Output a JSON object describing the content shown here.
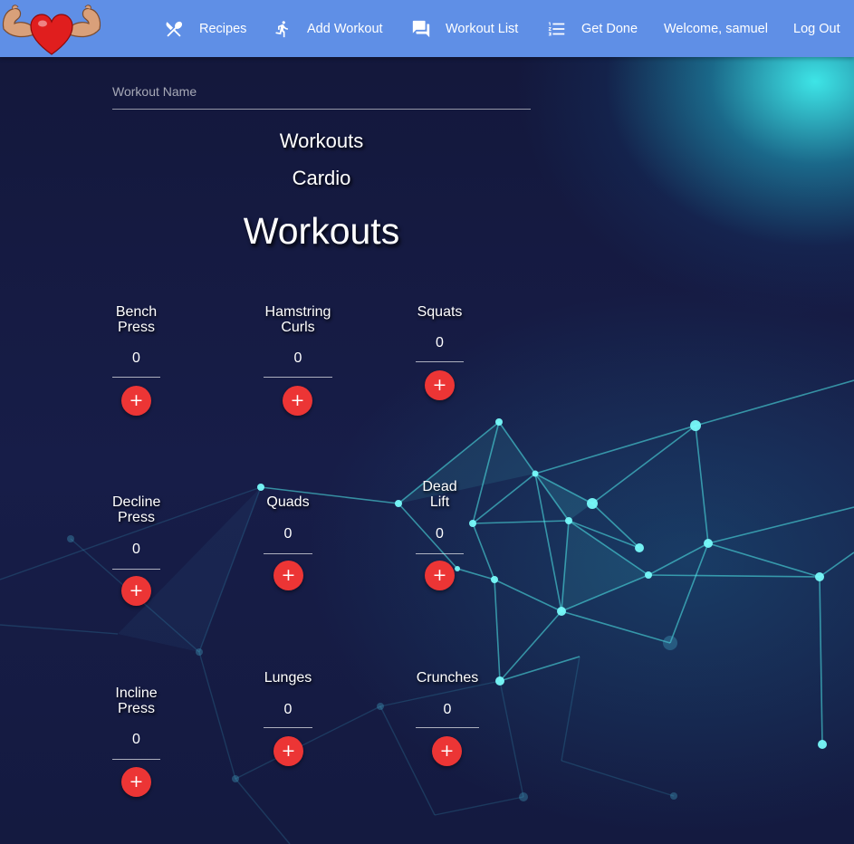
{
  "nav": {
    "items": [
      {
        "label": "Recipes",
        "icon": "fork-knife-icon"
      },
      {
        "label": "Add Workout",
        "icon": "running-person-icon"
      },
      {
        "label": "Workout List",
        "icon": "chat-bubbles-icon"
      },
      {
        "label": "Get Done",
        "icon": "numbered-list-icon"
      }
    ],
    "welcome": "Welcome, samuel",
    "logout": "Log Out"
  },
  "form": {
    "name_placeholder": "Workout Name",
    "name_value": ""
  },
  "categories": [
    "Workouts",
    "Cardio"
  ],
  "section_title": "Workouts",
  "workouts": [
    {
      "name": "Bench\nPress",
      "count": "0",
      "add": "+"
    },
    {
      "name": "Hamstring\nCurls",
      "count": "0",
      "add": "+"
    },
    {
      "name": "Squats",
      "count": "0",
      "add": "+"
    },
    {
      "name": "Decline\nPress",
      "count": "0",
      "add": "+"
    },
    {
      "name": "Quads",
      "count": "0",
      "add": "+"
    },
    {
      "name": "Dead\nLift",
      "count": "0",
      "add": "+"
    },
    {
      "name": "Incline\nPress",
      "count": "0",
      "add": "+"
    },
    {
      "name": "Lunges",
      "count": "0",
      "add": "+"
    },
    {
      "name": "Crunches",
      "count": "0",
      "add": "+"
    }
  ],
  "colors": {
    "navbar": "#5f8fe6",
    "background": "#141a3e",
    "add_button": "#ec3535",
    "accent": "#40f0f0"
  }
}
